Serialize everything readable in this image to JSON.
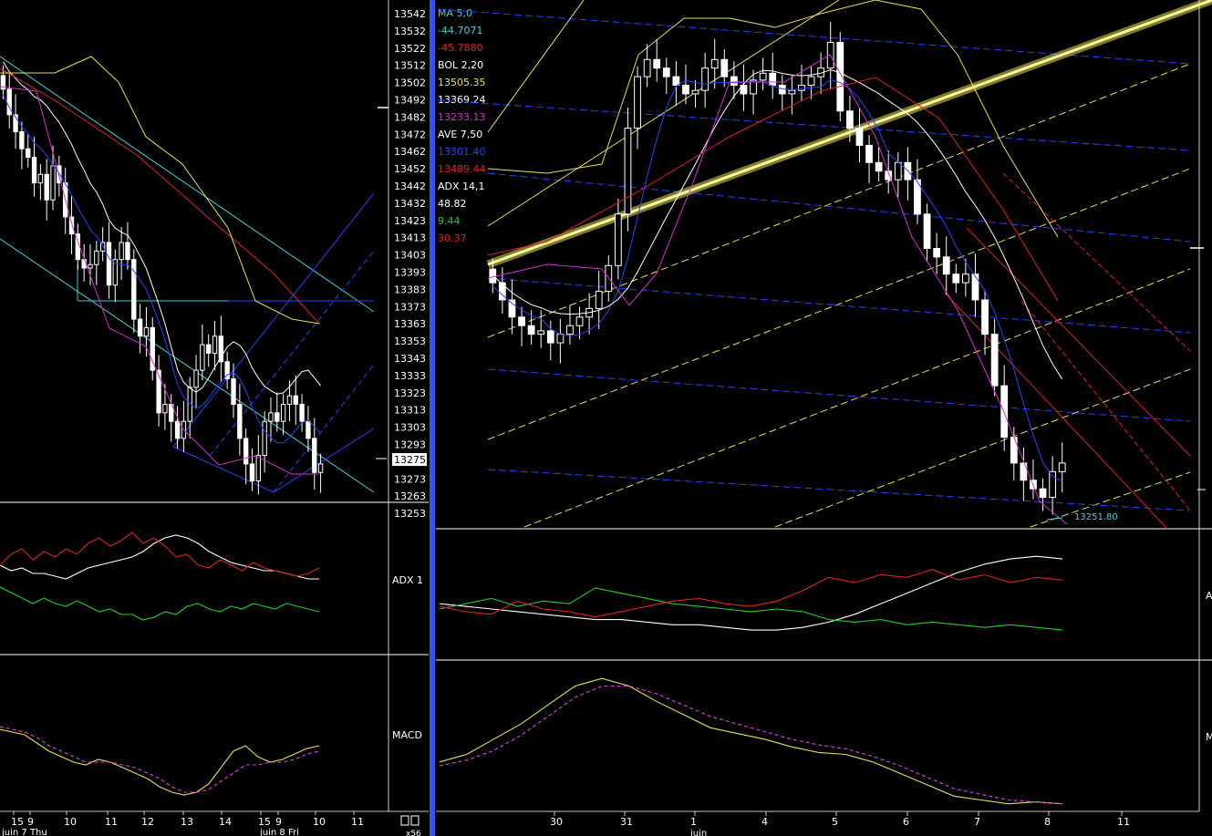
{
  "colors": {
    "background": "#000000",
    "divider": "#3355ee",
    "up_candle": "#ffffff",
    "down_candle": "#ffffff",
    "ma_white": "#ffffff",
    "ma_red": "#e02020",
    "boll_yellow": "#e8e050",
    "boll_magenta": "#d030d0",
    "ma_blue": "#2244ff",
    "adx_white": "#ffffff",
    "di_plus_green": "#20d020",
    "di_minus_red": "#e02020",
    "macd_yellow": "#e8e050",
    "signal_magenta": "#e040e0",
    "channel_blue": "#2244ff",
    "channel_yellow": "#e8e050",
    "channel_red": "#e02020",
    "cyan": "#40d0d0"
  },
  "left_panel": {
    "price_axis": {
      "ticks": [
        "13542",
        "13532",
        "13522",
        "13512",
        "13502",
        "13492",
        "13482",
        "13472",
        "13462",
        "13452",
        "13442",
        "13432",
        "13423",
        "13413",
        "13403",
        "13393",
        "13383",
        "13373",
        "13363",
        "13353",
        "13343",
        "13333",
        "13323",
        "13313",
        "13303",
        "13293",
        "13283",
        "13273",
        "13263",
        "13253"
      ],
      "current_price": "13275"
    },
    "indicator_legend": [
      {
        "text": "MA 5,0",
        "color": "#40d0d0"
      },
      {
        "text": "-44.7071",
        "color": "#40d0d0"
      },
      {
        "text": "-45.7880",
        "color": "#e02020"
      },
      {
        "text": "BOL  2,20",
        "color": "#ffffff"
      },
      {
        "text": "13505.35",
        "color": "#e8e050"
      },
      {
        "text": "13369.24",
        "color": "#ffffff"
      },
      {
        "text": "13233.13",
        "color": "#d030d0"
      },
      {
        "text": "AVE  7,50",
        "color": "#ffffff"
      },
      {
        "text": "13301.40",
        "color": "#2244ff"
      },
      {
        "text": "13489.44",
        "color": "#e02020"
      },
      {
        "text": "ADX  14,1",
        "color": "#ffffff"
      },
      {
        "text": " 48.82",
        "color": "#ffffff"
      },
      {
        "text": "  9.44",
        "color": "#20d020"
      },
      {
        "text": " 30.37",
        "color": "#e02020"
      }
    ],
    "adx_label": "ADX  1",
    "macd_label": "MACD",
    "time_ticks": [
      "15",
      "9",
      "10",
      "11",
      "12",
      "13",
      "14",
      "15",
      "9",
      "10",
      "11"
    ],
    "date_labels": [
      "juin 7 Thu",
      "juin 8 Fri"
    ],
    "corner_label": "x56"
  },
  "right_panel": {
    "low_annotation": "13251.80",
    "time_ticks": [
      "30",
      "31",
      "1",
      "4",
      "5",
      "6",
      "7",
      "8",
      "11"
    ],
    "date_label": "juin",
    "adx_side_label": "A",
    "macd_side_label": "M"
  },
  "chart_data": [
    {
      "type": "candlestick",
      "panel": "left-price",
      "title": "",
      "ylim": [
        13253,
        13542
      ],
      "x_tick_labels": [
        "15",
        "9",
        "10",
        "11",
        "12",
        "13",
        "14",
        "15",
        "9",
        "10",
        "11"
      ],
      "close_series": [
        13495,
        13480,
        13470,
        13460,
        13455,
        13440,
        13445,
        13430,
        13450,
        13440,
        13420,
        13410,
        13395,
        13390,
        13392,
        13400,
        13405,
        13380,
        13395,
        13405,
        13395,
        13360,
        13350,
        13355,
        13330,
        13305,
        13310,
        13300,
        13290,
        13300,
        13320,
        13330,
        13345,
        13340,
        13350,
        13335,
        13325,
        13310,
        13290,
        13275,
        13265,
        13280,
        13300,
        13305,
        13300,
        13310,
        13315,
        13310,
        13300,
        13290,
        13270,
        13275
      ]
    },
    {
      "type": "line",
      "panel": "left-adx",
      "series": [
        {
          "name": "ADX",
          "values": [
            30,
            28,
            29,
            27,
            27,
            26,
            25,
            27,
            29,
            30,
            31,
            32,
            33,
            35,
            38,
            40,
            41,
            40,
            38,
            35,
            33,
            31,
            30,
            29,
            28,
            28,
            27,
            26,
            25,
            25
          ]
        },
        {
          "name": "+DI",
          "values": [
            22,
            20,
            18,
            16,
            18,
            16,
            15,
            17,
            15,
            13,
            14,
            12,
            12,
            10,
            11,
            13,
            12,
            15,
            16,
            14,
            13,
            15,
            14,
            16,
            15,
            14,
            16,
            15,
            14,
            13
          ]
        },
        {
          "name": "-DI",
          "values": [
            30,
            34,
            36,
            32,
            35,
            33,
            36,
            34,
            38,
            40,
            37,
            39,
            42,
            38,
            40,
            37,
            33,
            34,
            30,
            29,
            32,
            30,
            28,
            31,
            29,
            28,
            27,
            26,
            27,
            29
          ]
        }
      ]
    },
    {
      "type": "line",
      "panel": "left-macd",
      "series": [
        {
          "name": "MACD",
          "values": [
            -10,
            -11,
            -12,
            -15,
            -18,
            -20,
            -22,
            -23,
            -21,
            -22,
            -24,
            -26,
            -28,
            -31,
            -33,
            -34,
            -33,
            -30,
            -24,
            -18,
            -16,
            -20,
            -22,
            -21,
            -19,
            -17,
            -16
          ]
        },
        {
          "name": "Signal",
          "values": [
            -9,
            -10,
            -11,
            -13,
            -16,
            -18,
            -20,
            -22,
            -22,
            -22,
            -23,
            -24,
            -26,
            -28,
            -31,
            -33,
            -33,
            -32,
            -29,
            -26,
            -23,
            -23,
            -22,
            -22,
            -21,
            -19,
            -18
          ]
        }
      ]
    },
    {
      "type": "candlestick",
      "panel": "right-price",
      "title": "",
      "x_tick_labels": [
        "30",
        "31",
        "1",
        "4",
        "5",
        "6",
        "7",
        "8",
        "11"
      ],
      "close_series": [
        13380,
        13370,
        13360,
        13355,
        13350,
        13352,
        13345,
        13350,
        13355,
        13360,
        13365,
        13375,
        13390,
        13420,
        13470,
        13500,
        13510,
        13505,
        13500,
        13495,
        13490,
        13492,
        13505,
        13510,
        13500,
        13495,
        13490,
        13498,
        13502,
        13495,
        13490,
        13492,
        13495,
        13500,
        13505,
        13520,
        13480,
        13470,
        13460,
        13450,
        13445,
        13440,
        13450,
        13440,
        13420,
        13400,
        13395,
        13385,
        13380,
        13385,
        13370,
        13350,
        13320,
        13290,
        13275,
        13265,
        13260,
        13255,
        13270,
        13275
      ]
    },
    {
      "type": "line",
      "panel": "right-adx",
      "series": [
        {
          "name": "ADX",
          "values": [
            20,
            19,
            18,
            17,
            16,
            15,
            14,
            14,
            13,
            12,
            12,
            11,
            10,
            10,
            11,
            13,
            16,
            20,
            24,
            28,
            32,
            35,
            37,
            38,
            37
          ]
        },
        {
          "name": "+DI",
          "values": [
            18,
            20,
            22,
            19,
            21,
            20,
            26,
            24,
            22,
            20,
            19,
            18,
            17,
            18,
            17,
            14,
            13,
            14,
            12,
            13,
            12,
            11,
            12,
            11,
            10
          ]
        },
        {
          "name": "-DI",
          "values": [
            19,
            17,
            16,
            21,
            18,
            17,
            15,
            17,
            19,
            21,
            22,
            20,
            19,
            21,
            25,
            30,
            28,
            31,
            30,
            33,
            29,
            31,
            28,
            30,
            29
          ]
        }
      ]
    },
    {
      "type": "line",
      "panel": "right-macd",
      "series": [
        {
          "name": "MACD",
          "values": [
            -10,
            -6,
            2,
            10,
            20,
            30,
            34,
            30,
            22,
            15,
            8,
            5,
            2,
            -2,
            -5,
            -6,
            -10,
            -16,
            -22,
            -28,
            -30,
            -32,
            -31,
            -32
          ]
        },
        {
          "name": "Signal",
          "values": [
            -12,
            -9,
            -4,
            4,
            14,
            24,
            30,
            30,
            26,
            20,
            14,
            10,
            6,
            2,
            -1,
            -3,
            -7,
            -12,
            -18,
            -24,
            -27,
            -30,
            -31,
            -32
          ]
        }
      ]
    }
  ]
}
